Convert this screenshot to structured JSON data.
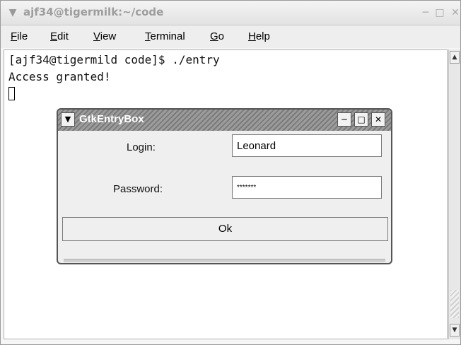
{
  "terminal": {
    "title": "ajf34@tigermilk:~/code",
    "menu": [
      {
        "label": "File",
        "mnemonic": "F",
        "rest": "ile"
      },
      {
        "label": "Edit",
        "mnemonic": "E",
        "rest": "dit"
      },
      {
        "label": "View",
        "mnemonic": "V",
        "rest": "iew"
      },
      {
        "label": "Terminal",
        "mnemonic": "T",
        "rest": "erminal"
      },
      {
        "label": "Go",
        "mnemonic": "G",
        "rest": "o"
      },
      {
        "label": "Help",
        "mnemonic": "H",
        "rest": "elp"
      }
    ],
    "lines": [
      "[ajf34@tigermild code]$ ./entry",
      "Access granted!"
    ]
  },
  "dialog": {
    "title": "GtkEntryBox",
    "login_label": "Login:",
    "login_value": "Leonard",
    "password_label": "Password:",
    "password_value": "*******",
    "ok_label": "Ok"
  },
  "icons": {
    "window_menu": "chevron-down-icon",
    "minimize": "minimize-icon",
    "maximize": "maximize-icon",
    "close": "close-icon",
    "scroll_up": "arrow-up-icon",
    "scroll_down": "arrow-down-icon"
  },
  "colors": {
    "dialog_title_text": "#ffffff",
    "terminal_background": "#ffffff"
  }
}
